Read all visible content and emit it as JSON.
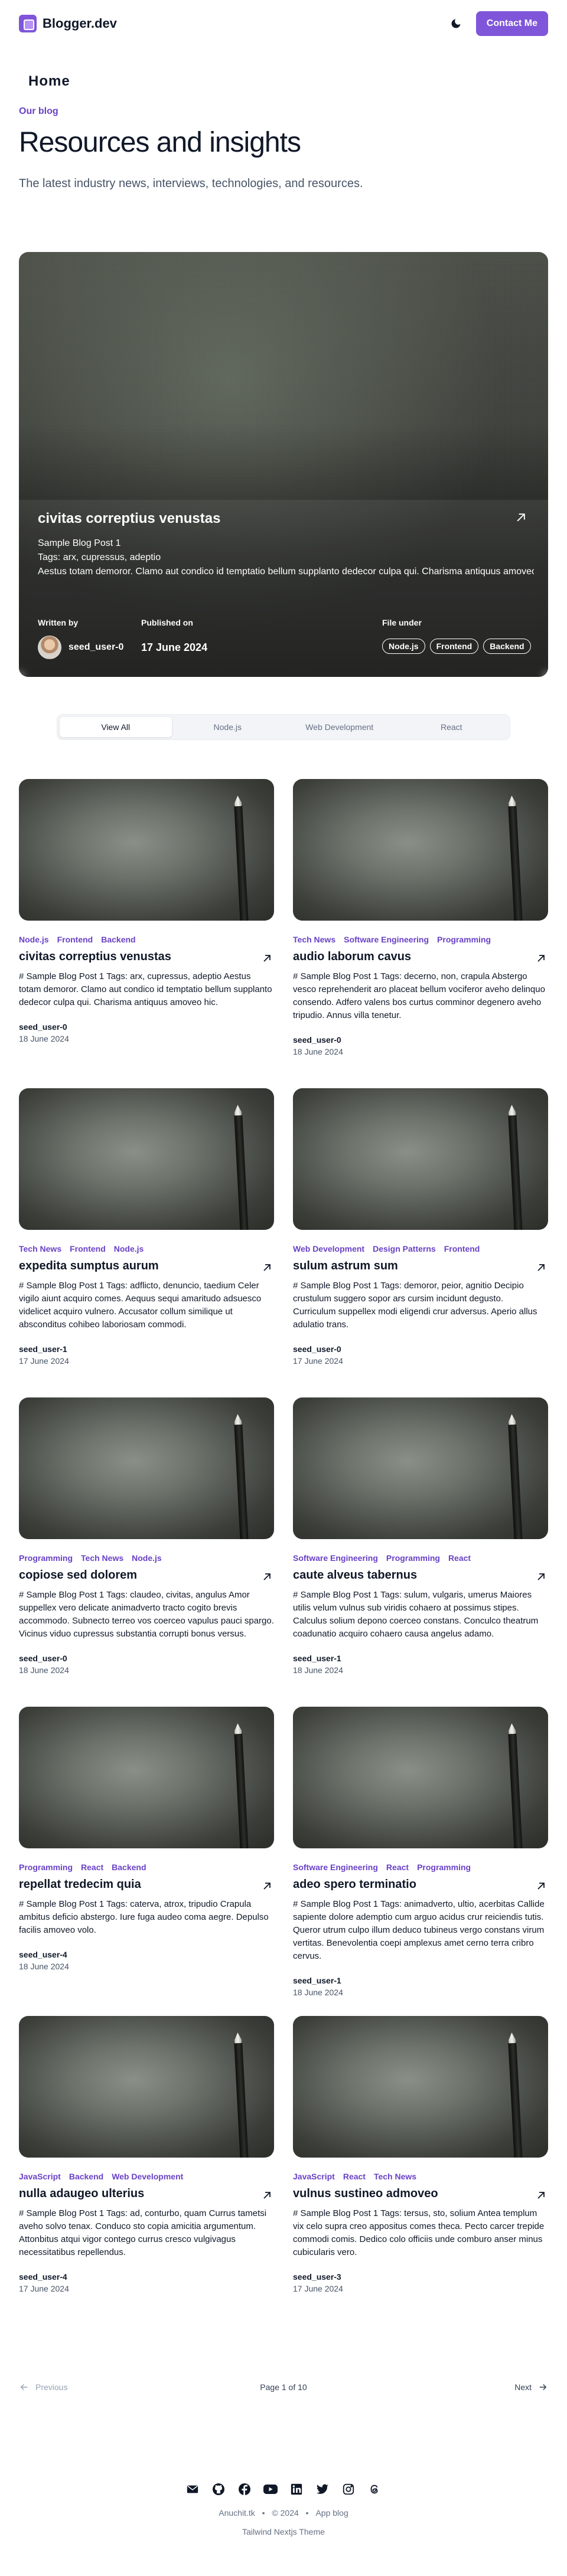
{
  "header": {
    "brand": "Blogger.dev",
    "contact_label": "Contact Me",
    "home_label": "Home"
  },
  "intro": {
    "eyebrow": "Our blog",
    "title": "Resources and insights",
    "subtitle": "The latest industry news, interviews, technologies, and resources."
  },
  "hero": {
    "title": "civitas correptius venustas",
    "line1": "Sample Blog Post 1",
    "line2": "Tags: arx, cupressus, adeptio",
    "line3": "Aestus totam demoror. Clamo aut condico id temptatio bellum supplanto dedecor culpa qui. Charisma antiquus amoveo hic.",
    "written_by_label": "Written by",
    "author": "seed_user-0",
    "published_label": "Published on",
    "published_date": "17 June 2024",
    "file_under_label": "File under",
    "tags": [
      "Node.js",
      "Frontend",
      "Backend"
    ]
  },
  "tabs": [
    "View All",
    "Node.js",
    "Web Development",
    "React"
  ],
  "active_tab": "View All",
  "posts": [
    {
      "tags": [
        "Node.js",
        "Frontend",
        "Backend"
      ],
      "title": "civitas correptius venustas",
      "body": "# Sample Blog Post 1 Tags: arx, cupressus, adeptio Aestus totam demoror. Clamo aut condico id temptatio bellum supplanto dedecor culpa qui. Charisma antiquus amoveo hic.",
      "author": "seed_user-0",
      "date": "18 June 2024"
    },
    {
      "tags": [
        "Tech News",
        "Software Engineering",
        "Programming"
      ],
      "title": "audio laborum cavus",
      "body": "# Sample Blog Post 1 Tags: decerno, non, crapula Abstergo vesco reprehenderit aro placeat bellum vociferor aveho delinquo consendo. Adfero valens bos curtus comminor degenero aveho tripudio. Annus villa tenetur.",
      "author": "seed_user-0",
      "date": "18 June 2024"
    },
    {
      "tags": [
        "Tech News",
        "Frontend",
        "Node.js"
      ],
      "title": "expedita sumptus aurum",
      "body": "# Sample Blog Post 1 Tags: adflicto, denuncio, taedium Celer vigilo aiunt acquiro comes. Aequus sequi amaritudo adsuesco videlicet acquiro vulnero. Accusator collum similique ut absconditus cohibeo laboriosam commodi.",
      "author": "seed_user-1",
      "date": "17 June 2024"
    },
    {
      "tags": [
        "Web Development",
        "Design Patterns",
        "Frontend"
      ],
      "title": "sulum astrum sum",
      "body": "# Sample Blog Post 1 Tags: demoror, peior, agnitio Decipio crustulum suggero sopor ars cursim incidunt degusto. Curriculum suppellex modi eligendi crur adversus. Aperio allus adulatio trans.",
      "author": "seed_user-0",
      "date": "17 June 2024"
    },
    {
      "tags": [
        "Programming",
        "Tech News",
        "Node.js"
      ],
      "title": "copiose sed dolorem",
      "body": "# Sample Blog Post 1 Tags: claudeo, civitas, angulus Amor suppellex vero delicate animadverto tracto cogito brevis accommodo. Subnecto terreo vos coerceo vapulus pauci spargo. Vicinus viduo cupressus substantia corrupti bonus versus.",
      "author": "seed_user-0",
      "date": "18 June 2024"
    },
    {
      "tags": [
        "Software Engineering",
        "Programming",
        "React"
      ],
      "title": "caute alveus tabernus",
      "body": "# Sample Blog Post 1 Tags: sulum, vulgaris, umerus Maiores utilis velum vulnus sub viridis cohaero at possimus stipes. Calculus solium depono coerceo constans. Conculco theatrum coadunatio acquiro cohaero causa angelus adamo.",
      "author": "seed_user-1",
      "date": "18 June 2024"
    },
    {
      "tags": [
        "Programming",
        "React",
        "Backend"
      ],
      "title": "repellat tredecim quia",
      "body": "# Sample Blog Post 1 Tags: caterva, atrox, tripudio Crapula ambitus deficio abstergo. Iure fuga audeo coma aegre. Depulso facilis amoveo volo.",
      "author": "seed_user-4",
      "date": "18 June 2024"
    },
    {
      "tags": [
        "Software Engineering",
        "React",
        "Programming"
      ],
      "title": "adeo spero terminatio",
      "body": "# Sample Blog Post 1 Tags: animadverto, ultio, acerbitas Callide sapiente dolore ademptio cum arguo acidus crur reiciendis tutis. Queror utrum culpo illum deduco tubineus vergo constans virum vertitas. Benevolentia coepi amplexus amet cerno terra cribro cervus.",
      "author": "seed_user-1",
      "date": "18 June 2024"
    },
    {
      "tags": [
        "JavaScript",
        "Backend",
        "Web Development"
      ],
      "title": "nulla adaugeo ulterius",
      "body": "# Sample Blog Post 1 Tags: ad, conturbo, quam Currus tametsi aveho solvo tenax. Conduco sto copia amicitia argumentum. Attonbitus atqui vigor contego currus cresco vulgivagus necessitatibus repellendus.",
      "author": "seed_user-4",
      "date": "17 June 2024"
    },
    {
      "tags": [
        "JavaScript",
        "React",
        "Tech News"
      ],
      "title": "vulnus sustineo admoveo",
      "body": "# Sample Blog Post 1 Tags: tersus, sto, solium Antea templum vix celo supra creo appositus comes theca. Pecto carcer trepide commodi comis. Dedico colo officiis unde comburo anser minus cubicularis vero.",
      "author": "seed_user-3",
      "date": "17 June 2024"
    }
  ],
  "pagination": {
    "prev_label": "Previous",
    "info": "Page 1 of 10",
    "next_label": "Next"
  },
  "footer": {
    "author": "Anuchit.tk",
    "sep": "•",
    "year": "© 2024",
    "blog": "App blog",
    "theme": "Tailwind Nextjs Theme",
    "icons": [
      "mail-icon",
      "github-icon",
      "facebook-icon",
      "youtube-icon",
      "linkedin-icon",
      "twitter-icon",
      "instagram-icon",
      "threads-icon"
    ]
  },
  "colors": {
    "accent": "#7f56d9",
    "tag_text": "#6941c6"
  }
}
